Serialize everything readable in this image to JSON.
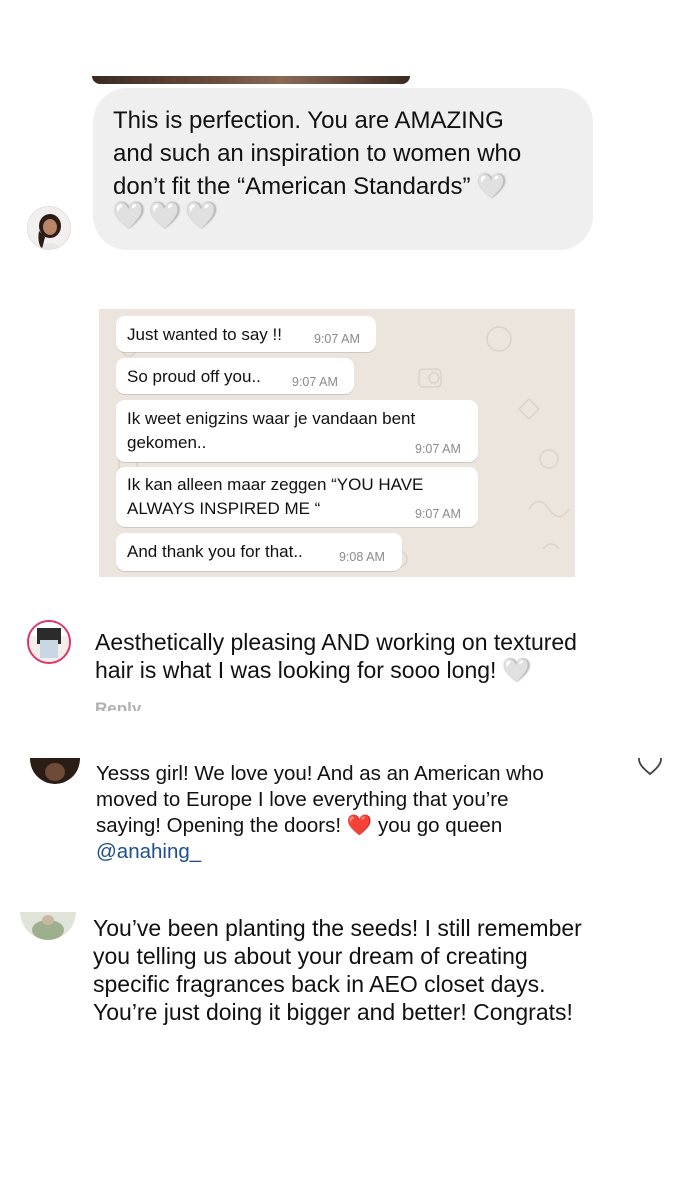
{
  "dm_message": {
    "line1": "This is perfection. You are AMAZING",
    "line2": "and such an inspiration to women who",
    "line3": "don’t fit the “American Standards”",
    "heart": "🤍",
    "hearts": "🤍🤍🤍"
  },
  "whatsapp": {
    "messages": [
      {
        "text": "Just wanted to say !!",
        "time": "9:07 AM"
      },
      {
        "text": "So proud off you..",
        "time": "9:07 AM"
      },
      {
        "line1": "Ik weet enigzins waar je vandaan bent",
        "line2": "gekomen..",
        "time": "9:07 AM"
      },
      {
        "line1": "Ik kan alleen maar zeggen “YOU HAVE",
        "line2": "ALWAYS INSPIRED ME “",
        "time": "9:07 AM"
      },
      {
        "text": "And thank you for that..",
        "time": "9:08 AM"
      }
    ]
  },
  "comments": [
    {
      "line1": "Aesthetically pleasing AND working on textured",
      "line2": "hair is what I was looking for sooo long!",
      "emoji": "🤍",
      "reply_label": "Reply"
    },
    {
      "line1": "Yesss girl! We love you! And as an American who",
      "line2": "moved to Europe I love everything that you’re",
      "line3a": "saying! Opening the doors!",
      "emoji": "❤️",
      "line3b": "you go queen",
      "mention": "@anahing_"
    },
    {
      "line1": "You’ve been planting the seeds! I still remember",
      "line2": "you telling us about your dream of creating",
      "line3": "specific fragrances back in AEO closet days.",
      "line4": "You’re just doing it bigger and better! Congrats!"
    }
  ],
  "icons": {
    "like_icon": "heart-outline",
    "avatars": [
      "dm-avatar",
      "commenter-avatar-1",
      "commenter-avatar-2",
      "commenter-avatar-3"
    ]
  }
}
